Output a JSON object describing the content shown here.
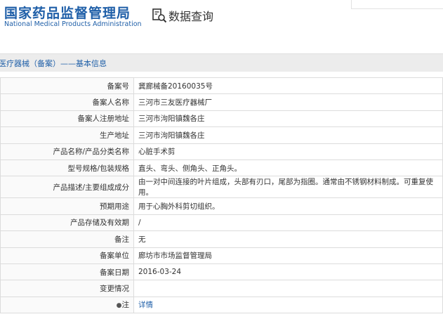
{
  "header": {
    "logo_cn": "国家药品监督管理局",
    "logo_en": "National Medical Products Administration",
    "query_title": "数据查询",
    "query_icon": "search-document-icon"
  },
  "section": {
    "title": "医疗器械（备案）——基本信息"
  },
  "rows": [
    {
      "label": "备案号",
      "value": "冀廊械备20160035号"
    },
    {
      "label": "备案人名称",
      "value": "三河市三友医疗器械厂"
    },
    {
      "label": "备案人注册地址",
      "value": "三河市泃阳镇魏各庄"
    },
    {
      "label": "生产地址",
      "value": "三河市泃阳镇魏各庄"
    },
    {
      "label": "产品名称/产品分类名称",
      "value": "心脏手术剪"
    },
    {
      "label": "型号规格/包装规格",
      "value": "直头、弯头、侧角头、正角头。"
    },
    {
      "label": "产品描述/主要组成成分",
      "value": "由一对中间连接的叶片组成，头部有刃口，尾部为指圈。通常由不锈钢材料制成。可重复使用。"
    },
    {
      "label": "预期用途",
      "value": "用于心胸外科剪切组织。"
    },
    {
      "label": "产品存储及有效期",
      "value": "/"
    },
    {
      "label": "备注",
      "value": "无"
    },
    {
      "label": "备案单位",
      "value": "廊坊市市场监督管理局"
    },
    {
      "label": "备案日期",
      "value": "2016-03-24"
    },
    {
      "label": "变更情况",
      "value": ""
    }
  ],
  "note_row": {
    "label": "注",
    "pin_icon": "pin-icon",
    "link": "详情"
  }
}
